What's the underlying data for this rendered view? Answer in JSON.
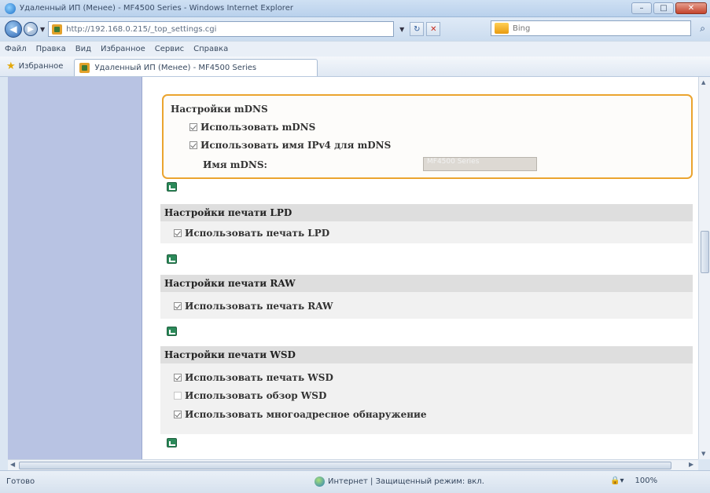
{
  "window": {
    "title": "Удаленный ИП (Менее) - MF4500 Series - Windows Internet Explorer",
    "controls": {
      "minimize": "–",
      "maximize": "□",
      "close": "✕"
    }
  },
  "address_bar": {
    "url": "http://192.168.0.215/_top_settings.cgi",
    "search_placeholder": "Bing"
  },
  "menu": [
    "Файл",
    "Правка",
    "Вид",
    "Избранное",
    "Сервис",
    "Справка"
  ],
  "favorites_label": "Избранное",
  "tab_title": "Удаленный ИП (Менее) - MF4500 Series",
  "mdns": {
    "title": "Настройки mDNS",
    "use_mdns": "Использовать mDNS",
    "use_ipv4_name": "Использовать имя IPv4 для mDNS",
    "name_label": "Имя mDNS:",
    "name_value": "MF4500 Series"
  },
  "lpd": {
    "title": "Настройки печати LPD",
    "use_lpd": "Использовать печать LPD"
  },
  "raw": {
    "title": "Настройки печати RAW",
    "use_raw": "Использовать печать RAW"
  },
  "wsd": {
    "title": "Настройки печати WSD",
    "use_wsd": "Использовать печать WSD",
    "use_wsd_browse": "Использовать обзор WSD",
    "use_multicast": "Использовать многоадресное обнаружение"
  },
  "status": {
    "left": "Готово",
    "zone": "Интернет | Защищенный режим: вкл.",
    "zoom": "100%"
  }
}
